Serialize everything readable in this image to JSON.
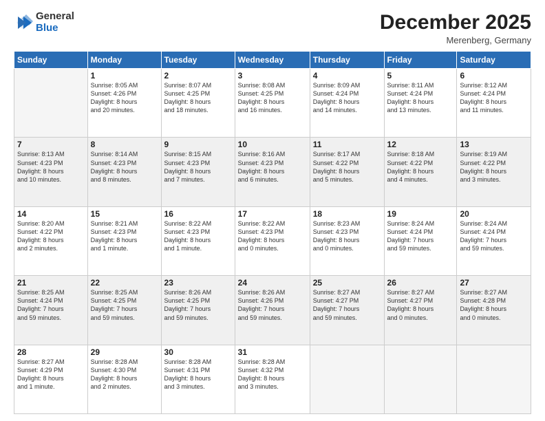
{
  "header": {
    "logo_general": "General",
    "logo_blue": "Blue",
    "month": "December 2025",
    "location": "Merenberg, Germany"
  },
  "weekdays": [
    "Sunday",
    "Monday",
    "Tuesday",
    "Wednesday",
    "Thursday",
    "Friday",
    "Saturday"
  ],
  "weeks": [
    [
      {
        "day": "",
        "info": ""
      },
      {
        "day": "1",
        "info": "Sunrise: 8:05 AM\nSunset: 4:26 PM\nDaylight: 8 hours\nand 20 minutes."
      },
      {
        "day": "2",
        "info": "Sunrise: 8:07 AM\nSunset: 4:25 PM\nDaylight: 8 hours\nand 18 minutes."
      },
      {
        "day": "3",
        "info": "Sunrise: 8:08 AM\nSunset: 4:25 PM\nDaylight: 8 hours\nand 16 minutes."
      },
      {
        "day": "4",
        "info": "Sunrise: 8:09 AM\nSunset: 4:24 PM\nDaylight: 8 hours\nand 14 minutes."
      },
      {
        "day": "5",
        "info": "Sunrise: 8:11 AM\nSunset: 4:24 PM\nDaylight: 8 hours\nand 13 minutes."
      },
      {
        "day": "6",
        "info": "Sunrise: 8:12 AM\nSunset: 4:24 PM\nDaylight: 8 hours\nand 11 minutes."
      }
    ],
    [
      {
        "day": "7",
        "info": "Sunrise: 8:13 AM\nSunset: 4:23 PM\nDaylight: 8 hours\nand 10 minutes."
      },
      {
        "day": "8",
        "info": "Sunrise: 8:14 AM\nSunset: 4:23 PM\nDaylight: 8 hours\nand 8 minutes."
      },
      {
        "day": "9",
        "info": "Sunrise: 8:15 AM\nSunset: 4:23 PM\nDaylight: 8 hours\nand 7 minutes."
      },
      {
        "day": "10",
        "info": "Sunrise: 8:16 AM\nSunset: 4:23 PM\nDaylight: 8 hours\nand 6 minutes."
      },
      {
        "day": "11",
        "info": "Sunrise: 8:17 AM\nSunset: 4:22 PM\nDaylight: 8 hours\nand 5 minutes."
      },
      {
        "day": "12",
        "info": "Sunrise: 8:18 AM\nSunset: 4:22 PM\nDaylight: 8 hours\nand 4 minutes."
      },
      {
        "day": "13",
        "info": "Sunrise: 8:19 AM\nSunset: 4:22 PM\nDaylight: 8 hours\nand 3 minutes."
      }
    ],
    [
      {
        "day": "14",
        "info": "Sunrise: 8:20 AM\nSunset: 4:22 PM\nDaylight: 8 hours\nand 2 minutes."
      },
      {
        "day": "15",
        "info": "Sunrise: 8:21 AM\nSunset: 4:23 PM\nDaylight: 8 hours\nand 1 minute."
      },
      {
        "day": "16",
        "info": "Sunrise: 8:22 AM\nSunset: 4:23 PM\nDaylight: 8 hours\nand 1 minute."
      },
      {
        "day": "17",
        "info": "Sunrise: 8:22 AM\nSunset: 4:23 PM\nDaylight: 8 hours\nand 0 minutes."
      },
      {
        "day": "18",
        "info": "Sunrise: 8:23 AM\nSunset: 4:23 PM\nDaylight: 8 hours\nand 0 minutes."
      },
      {
        "day": "19",
        "info": "Sunrise: 8:24 AM\nSunset: 4:24 PM\nDaylight: 7 hours\nand 59 minutes."
      },
      {
        "day": "20",
        "info": "Sunrise: 8:24 AM\nSunset: 4:24 PM\nDaylight: 7 hours\nand 59 minutes."
      }
    ],
    [
      {
        "day": "21",
        "info": "Sunrise: 8:25 AM\nSunset: 4:24 PM\nDaylight: 7 hours\nand 59 minutes."
      },
      {
        "day": "22",
        "info": "Sunrise: 8:25 AM\nSunset: 4:25 PM\nDaylight: 7 hours\nand 59 minutes."
      },
      {
        "day": "23",
        "info": "Sunrise: 8:26 AM\nSunset: 4:25 PM\nDaylight: 7 hours\nand 59 minutes."
      },
      {
        "day": "24",
        "info": "Sunrise: 8:26 AM\nSunset: 4:26 PM\nDaylight: 7 hours\nand 59 minutes."
      },
      {
        "day": "25",
        "info": "Sunrise: 8:27 AM\nSunset: 4:27 PM\nDaylight: 7 hours\nand 59 minutes."
      },
      {
        "day": "26",
        "info": "Sunrise: 8:27 AM\nSunset: 4:27 PM\nDaylight: 8 hours\nand 0 minutes."
      },
      {
        "day": "27",
        "info": "Sunrise: 8:27 AM\nSunset: 4:28 PM\nDaylight: 8 hours\nand 0 minutes."
      }
    ],
    [
      {
        "day": "28",
        "info": "Sunrise: 8:27 AM\nSunset: 4:29 PM\nDaylight: 8 hours\nand 1 minute."
      },
      {
        "day": "29",
        "info": "Sunrise: 8:28 AM\nSunset: 4:30 PM\nDaylight: 8 hours\nand 2 minutes."
      },
      {
        "day": "30",
        "info": "Sunrise: 8:28 AM\nSunset: 4:31 PM\nDaylight: 8 hours\nand 3 minutes."
      },
      {
        "day": "31",
        "info": "Sunrise: 8:28 AM\nSunset: 4:32 PM\nDaylight: 8 hours\nand 3 minutes."
      },
      {
        "day": "",
        "info": ""
      },
      {
        "day": "",
        "info": ""
      },
      {
        "day": "",
        "info": ""
      }
    ]
  ]
}
